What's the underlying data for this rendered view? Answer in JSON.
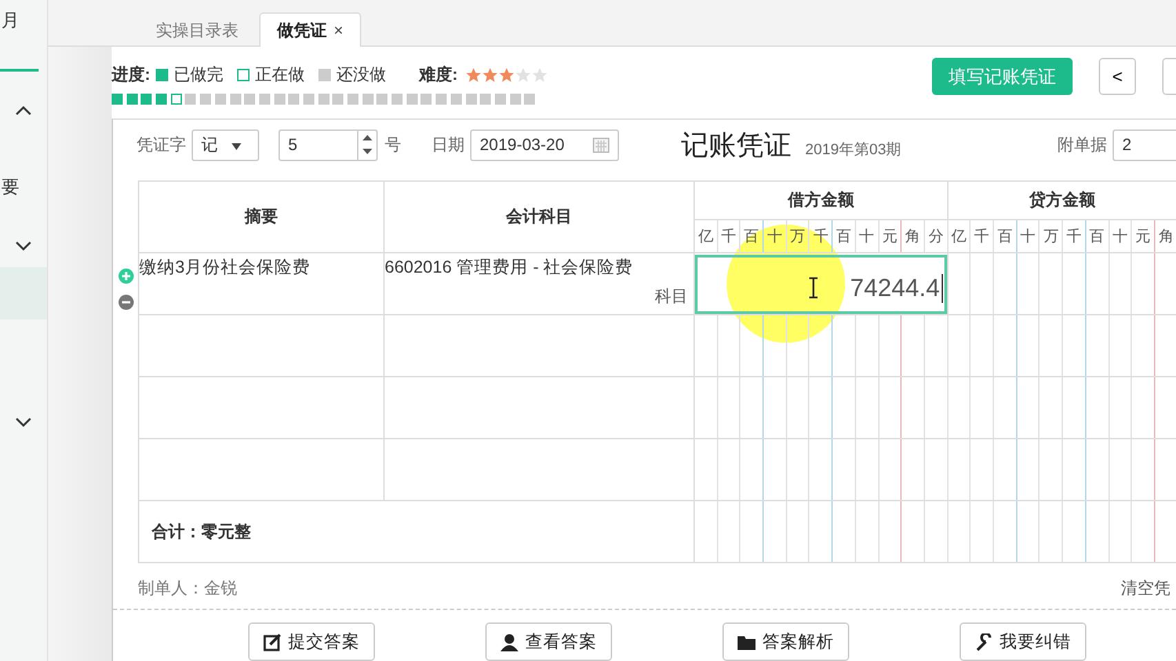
{
  "sidebar": {
    "items": [
      {
        "kind": "text",
        "label": "月",
        "selected": false
      },
      {
        "kind": "divider",
        "selected": false
      },
      {
        "kind": "chevron",
        "expanded": true,
        "selected": false
      },
      {
        "kind": "text",
        "label": "要",
        "selected": false
      },
      {
        "kind": "chevron",
        "expanded": false,
        "selected": false
      },
      {
        "kind": "blank",
        "selected": true
      },
      {
        "kind": "chevron",
        "expanded": false,
        "selected": false
      }
    ]
  },
  "tabs": [
    {
      "label": "实操目录表",
      "selected": false
    },
    {
      "label": "做凭证",
      "selected": true,
      "close": "×"
    }
  ],
  "progress": {
    "label": "进度:",
    "legend": [
      {
        "kind": "done",
        "label": "已做完"
      },
      {
        "kind": "current",
        "label": "正在做"
      },
      {
        "kind": "todo",
        "label": "还没做"
      }
    ],
    "steps": [
      {
        "kind": "done"
      },
      {
        "kind": "done"
      },
      {
        "kind": "done"
      },
      {
        "kind": "done"
      },
      {
        "kind": "current"
      },
      {
        "kind": "todo"
      },
      {
        "kind": "todo"
      },
      {
        "kind": "todo"
      },
      {
        "kind": "todo"
      },
      {
        "kind": "todo"
      },
      {
        "kind": "todo"
      },
      {
        "kind": "todo"
      },
      {
        "kind": "todo"
      },
      {
        "kind": "todo"
      },
      {
        "kind": "todo"
      },
      {
        "kind": "todo"
      },
      {
        "kind": "todo"
      },
      {
        "kind": "todo"
      },
      {
        "kind": "todo"
      },
      {
        "kind": "todo"
      },
      {
        "kind": "todo"
      },
      {
        "kind": "todo"
      },
      {
        "kind": "todo"
      },
      {
        "kind": "todo"
      },
      {
        "kind": "todo"
      },
      {
        "kind": "todo"
      },
      {
        "kind": "todo"
      },
      {
        "kind": "todo"
      },
      {
        "kind": "todo"
      }
    ]
  },
  "difficulty": {
    "label": "难度:",
    "stars": 3
  },
  "fill_button": "填写记账凭证",
  "nav": {
    "prev": "<"
  },
  "voucher": {
    "word_label": "凭证字",
    "word": "记",
    "number": "5",
    "number_suffix": "号",
    "date_label": "日期",
    "date": "2019-03-20",
    "title": "记账凭证",
    "period": "2019年第03期",
    "attachments_label": "附单据",
    "attachments": "2",
    "columns": {
      "summary": "摘要",
      "account": "会计科目",
      "debit": "借方金额",
      "credit": "贷方金额"
    },
    "debit_units": [
      "亿",
      "千",
      "百",
      "十",
      "万",
      "千",
      "百",
      "十",
      "元",
      "角",
      "分"
    ],
    "credit_units": [
      "亿",
      "千",
      "百",
      "十",
      "万",
      "千",
      "百",
      "十",
      "元",
      "角"
    ],
    "rows": [
      {
        "summary": "缴纳3月份社会保险费",
        "account": "6602016 管理费用 - 社会保险费",
        "account_hint": "科目",
        "debit": "74244.4",
        "editing": true
      },
      {
        "editing": false
      },
      {
        "editing": false
      },
      {
        "editing": false
      }
    ],
    "row_actions": [
      {
        "kind": "add"
      },
      {
        "kind": "remove"
      }
    ],
    "total": "合计：零元整",
    "maker": "制单人：金锐",
    "clear": "清空凭"
  },
  "buttons": [
    {
      "kind": "submit",
      "label": "提交答案"
    },
    {
      "kind": "view",
      "label": "查看答案"
    },
    {
      "kind": "explain",
      "label": "答案解析"
    },
    {
      "kind": "report",
      "label": "我要纠错"
    }
  ]
}
